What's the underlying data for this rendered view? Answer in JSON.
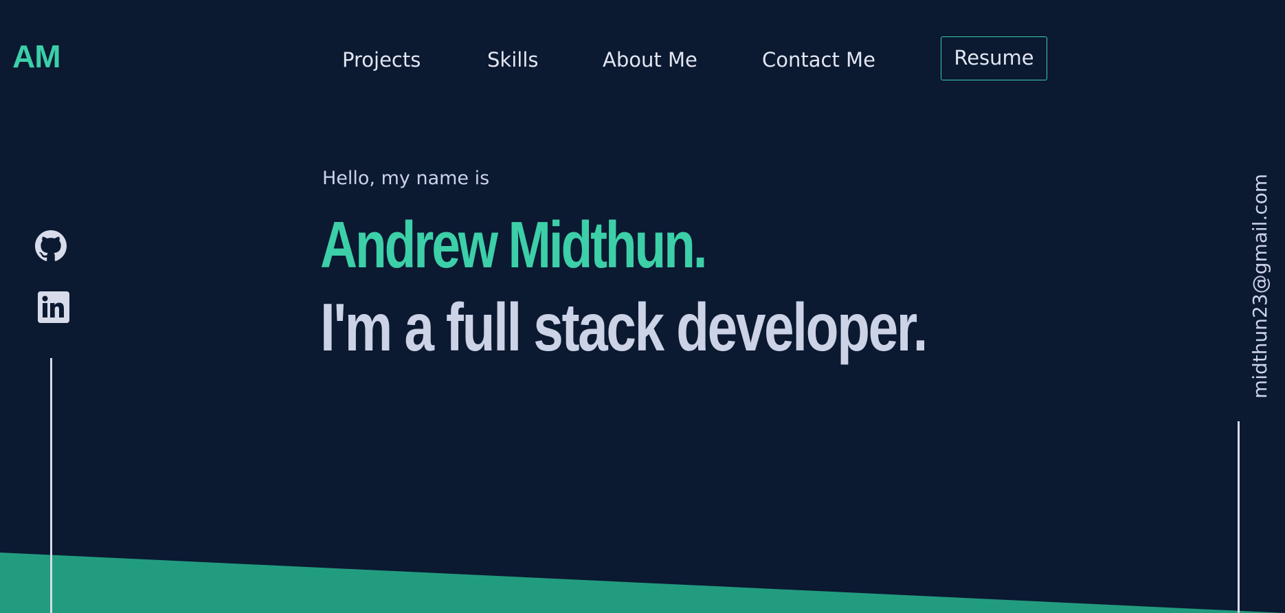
{
  "logo": {
    "text": "AM"
  },
  "nav": {
    "items": [
      {
        "label": "Projects"
      },
      {
        "label": "Skills"
      },
      {
        "label": "About Me"
      },
      {
        "label": "Contact Me"
      }
    ],
    "resume_label": "Resume"
  },
  "hero": {
    "intro": "Hello, my name is",
    "name": "Andrew Midthun.",
    "tagline": "I'm a full stack developer."
  },
  "social": {
    "github_icon": "github-icon",
    "linkedin_icon": "linkedin-icon",
    "email": "midthun23@gmail.com"
  },
  "colors": {
    "background": "#0b1931",
    "accent": "#3ccfa8",
    "text": "#ccd3e6",
    "wedge": "#229c7f"
  }
}
